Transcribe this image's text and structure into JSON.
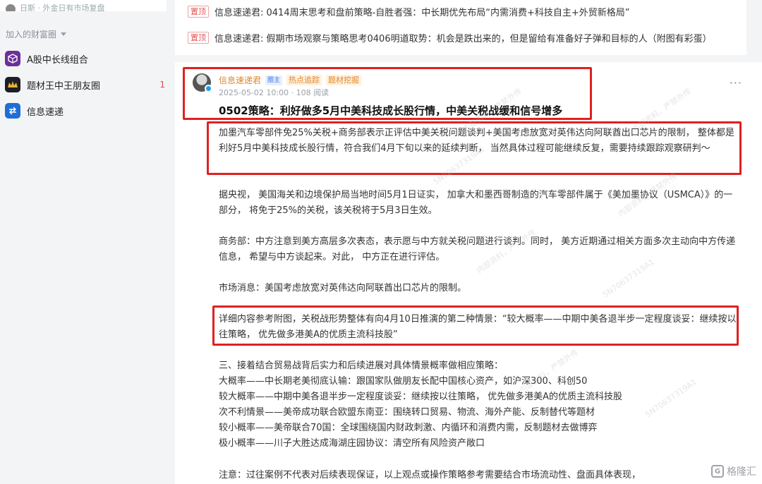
{
  "sidebar": {
    "top_text": "日斯 · 外金日有市场复盘",
    "section_title": "加入的财富圈",
    "items": [
      {
        "label": "A股中长线组合",
        "icon": "portfolio-icon",
        "badge": ""
      },
      {
        "label": "题材王中王朋友圈",
        "icon": "crown-icon",
        "badge": "1"
      },
      {
        "label": "信息速递",
        "icon": "exchange-icon",
        "badge": ""
      }
    ]
  },
  "pinned": {
    "tag": "置顶",
    "items": [
      "信息速递君: 0414周末思考和盘前策略-自胜者强：中长期优先布局“内需消费+科技自主+外贸新格局”",
      "信息速递君: 假期市场观察与策略思考0406明道取势：机会是跌出来的，但是留给有准备好子弹和目标的人（附图有彩蛋）"
    ]
  },
  "post": {
    "author": "信息速递君",
    "owner_tag": "圈主",
    "topic_tags": [
      "热点追踪",
      "题材挖掘"
    ],
    "meta": "2025-05-02 10:00 · 108 阅读",
    "more": "···",
    "title": "0502策略：利好做多5月中美科技成长股行情，中美关税战缓和信号增多",
    "paragraphs": [
      "加墨汽车零部件免25%关税+商务部表示正评估中美关税问题谈判+美国考虑放宽对英伟达向阿联酋出口芯片的限制， 整体都是利好5月中美科技成长股行情，符合我们4月下旬以来的延续判断， 当然具体过程可能继续反复，需要持续跟踪观察研判～",
      "据央视， 美国海关和边境保护局当地时间5月1日证实， 加拿大和墨西哥制造的汽车零部件属于《美加墨协议（USMCA）》的一部分， 将免于25%的关税，该关税将于5月3日生效。",
      "商务部：中方注意到美方高层多次表态，表示愿与中方就关税问题进行谈判。同时， 美方近期通过相关方面多次主动向中方传递信息， 希望与中方谈起来。对此， 中方正在进行评估。",
      "市场消息：美国考虑放宽对英伟达向阿联酋出口芯片的限制。",
      "详细内容参考附图，关税战形势整体有向4月10日推演的第二种情景：“较大概率——中期中美各退半步一定程度谈妥：继续按以往策略， 优先做多港美A的优质主流科技股”"
    ],
    "scenario_header": "三、接着结合贸易战背后实力和后续进展对具体情景概率做相应策略：",
    "scenarios": [
      "大概率——中长期老美彻底认输：跟国家队做朋友长配中国核心资产，如沪深300、科创50",
      "较大概率——中期中美各退半步一定程度谈妥：继续按以往策略， 优先做多港美A的优质主流科技股",
      "次不利情景——美帝成功联合欧盟东南亚：围绕转口贸易、物流、海外产能、反制替代等题材",
      "较小概率——美帝联合70国：全球围绕国内财政刺激、内循环和消费内需，反制题材去做博弈",
      "极小概率——川子大胜达成海湖庄园协议：清空所有风险资产敞口"
    ],
    "note": "注意：过往案例不代表对后续表现保证，以上观点或操作策略参考需要结合市场流动性、盘面具体表现，"
  },
  "watermark": {
    "text_a": "内部资料，严禁外传",
    "text_b": "5N70637319A1",
    "logo_text": "格隆汇"
  },
  "colors": {
    "highlight": "#e02020",
    "accent": "#e0872c",
    "pin": "#e25555"
  }
}
